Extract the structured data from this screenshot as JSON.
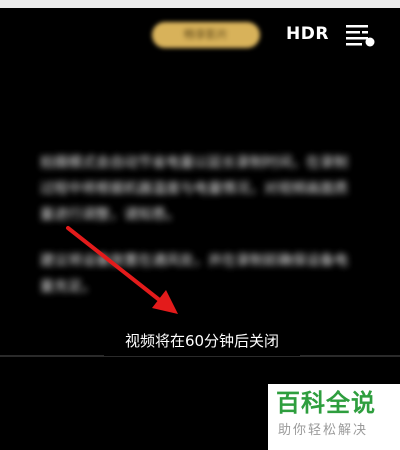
{
  "top_bar": {
    "pill_label": "畅享影片",
    "hdr_label": "HDR",
    "settings_icon": "settings-sliders-icon"
  },
  "notice": {
    "paragraphs": [
      "拍摄模式会自动节省电量以延长录制时间，在录制过程中将根据机器温度与电量情况，对视频画面质量进行调整，请知悉。",
      "建议将设备放置在通风处，并在录制前确保设备电量充足。"
    ]
  },
  "annotation": {
    "arrow_icon": "red-arrow-icon",
    "arrow_color": "#e31b1b"
  },
  "toast": {
    "text": "视频将在60分钟后关闭"
  },
  "watermark": {
    "title": "百科全说",
    "subtitle": "助你轻松解决",
    "title_color": "#2e9e3e"
  }
}
